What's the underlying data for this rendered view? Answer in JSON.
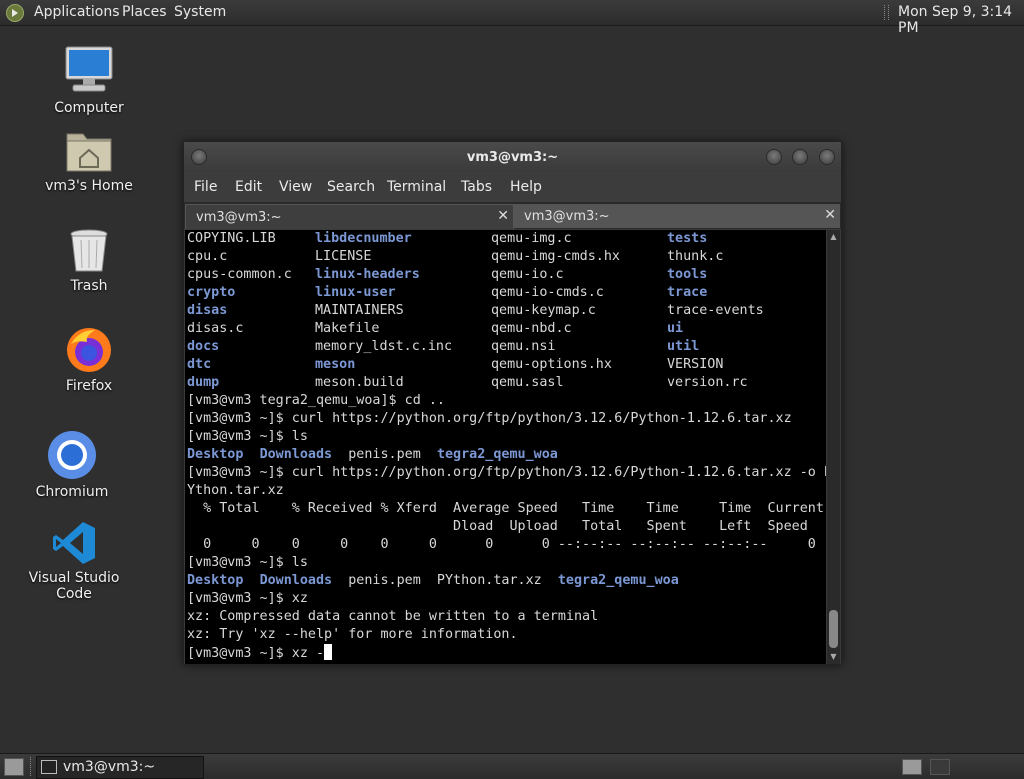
{
  "top_panel": {
    "menus": [
      "Applications",
      "Places",
      "System"
    ],
    "clock": "Mon Sep  9,  3:14 PM"
  },
  "desktop": {
    "icons": [
      {
        "label": "Computer",
        "icon": "computer-icon"
      },
      {
        "label": "vm3's Home",
        "icon": "home-folder-icon"
      },
      {
        "label": "Trash",
        "icon": "trash-icon"
      },
      {
        "label": "Firefox",
        "icon": "firefox-icon"
      },
      {
        "label": "Chromium",
        "icon": "chromium-icon"
      },
      {
        "label": "Visual Studio Code",
        "icon": "vscode-icon"
      }
    ]
  },
  "window": {
    "title": "vm3@vm3:~",
    "menus": [
      "File",
      "Edit",
      "View",
      "Search",
      "Terminal",
      "Tabs",
      "Help"
    ],
    "tabs": [
      {
        "label": "vm3@vm3:~",
        "active": true
      },
      {
        "label": "vm3@vm3:~",
        "active": false
      }
    ],
    "close_glyph": "✕"
  },
  "terminal": {
    "listing": [
      [
        {
          "t": "COPYING.LIB",
          "d": false
        },
        {
          "t": "libdecnumber",
          "d": true
        },
        {
          "t": "qemu-img.c",
          "d": false
        },
        {
          "t": "tests",
          "d": true
        }
      ],
      [
        {
          "t": "cpu.c",
          "d": false
        },
        {
          "t": "LICENSE",
          "d": false
        },
        {
          "t": "qemu-img-cmds.hx",
          "d": false
        },
        {
          "t": "thunk.c",
          "d": false
        }
      ],
      [
        {
          "t": "cpus-common.c",
          "d": false
        },
        {
          "t": "linux-headers",
          "d": true
        },
        {
          "t": "qemu-io.c",
          "d": false
        },
        {
          "t": "tools",
          "d": true
        }
      ],
      [
        {
          "t": "crypto",
          "d": true
        },
        {
          "t": "linux-user",
          "d": true
        },
        {
          "t": "qemu-io-cmds.c",
          "d": false
        },
        {
          "t": "trace",
          "d": true
        }
      ],
      [
        {
          "t": "disas",
          "d": true
        },
        {
          "t": "MAINTAINERS",
          "d": false
        },
        {
          "t": "qemu-keymap.c",
          "d": false
        },
        {
          "t": "trace-events",
          "d": false
        }
      ],
      [
        {
          "t": "disas.c",
          "d": false
        },
        {
          "t": "Makefile",
          "d": false
        },
        {
          "t": "qemu-nbd.c",
          "d": false
        },
        {
          "t": "ui",
          "d": true
        }
      ],
      [
        {
          "t": "docs",
          "d": true
        },
        {
          "t": "memory_ldst.c.inc",
          "d": false
        },
        {
          "t": "qemu.nsi",
          "d": false
        },
        {
          "t": "util",
          "d": true
        }
      ],
      [
        {
          "t": "dtc",
          "d": true
        },
        {
          "t": "meson",
          "d": true
        },
        {
          "t": "qemu-options.hx",
          "d": false
        },
        {
          "t": "VERSION",
          "d": false
        }
      ],
      [
        {
          "t": "dump",
          "d": true
        },
        {
          "t": "meson.build",
          "d": false
        },
        {
          "t": "qemu.sasl",
          "d": false
        },
        {
          "t": "version.rc",
          "d": false
        }
      ]
    ],
    "lines": [
      [
        {
          "t": "[vm3@vm3 tegra2_qemu_woa]$ cd ..",
          "d": false
        }
      ],
      [
        {
          "t": "[vm3@vm3 ~]$ curl https://python.org/ftp/python/3.12.6/Python-1.12.6.tar.xz",
          "d": false
        }
      ],
      [
        {
          "t": "[vm3@vm3 ~]$ ls",
          "d": false
        }
      ],
      [
        {
          "t": "Desktop",
          "d": true
        },
        {
          "t": "  ",
          "d": false
        },
        {
          "t": "Downloads",
          "d": true
        },
        {
          "t": "  penis.pem  ",
          "d": false
        },
        {
          "t": "tegra2_qemu_woa",
          "d": true
        }
      ],
      [
        {
          "t": "[vm3@vm3 ~]$ curl https://python.org/ftp/python/3.12.6/Python-1.12.6.tar.xz -o P",
          "d": false
        }
      ],
      [
        {
          "t": "Ython.tar.xz",
          "d": false
        }
      ],
      [
        {
          "t": "  % Total    % Received % Xferd  Average Speed   Time    Time     Time  Current",
          "d": false
        }
      ],
      [
        {
          "t": "                                 Dload  Upload   Total   Spent    Left  Speed",
          "d": false
        }
      ],
      [
        {
          "t": "  0     0    0     0    0     0      0      0 --:--:-- --:--:-- --:--:--     0",
          "d": false
        }
      ],
      [
        {
          "t": "[vm3@vm3 ~]$ ls",
          "d": false
        }
      ],
      [
        {
          "t": "Desktop",
          "d": true
        },
        {
          "t": "  ",
          "d": false
        },
        {
          "t": "Downloads",
          "d": true
        },
        {
          "t": "  penis.pem  PYthon.tar.xz  ",
          "d": false
        },
        {
          "t": "tegra2_qemu_woa",
          "d": true
        }
      ],
      [
        {
          "t": "[vm3@vm3 ~]$ xz",
          "d": false
        }
      ],
      [
        {
          "t": "xz: Compressed data cannot be written to a terminal",
          "d": false
        }
      ],
      [
        {
          "t": "xz: Try 'xz --help' for more information.",
          "d": false
        }
      ],
      [
        {
          "t": "[vm3@vm3 ~]$ xz -",
          "d": false
        }
      ]
    ]
  },
  "taskbar": {
    "task_label": "vm3@vm3:~"
  },
  "colors": {
    "directory": "#7c98d4",
    "terminal_bg": "#000000",
    "terminal_fg": "#d8d8d8",
    "panel": "#333333",
    "desktop": "#2f2f2f"
  }
}
